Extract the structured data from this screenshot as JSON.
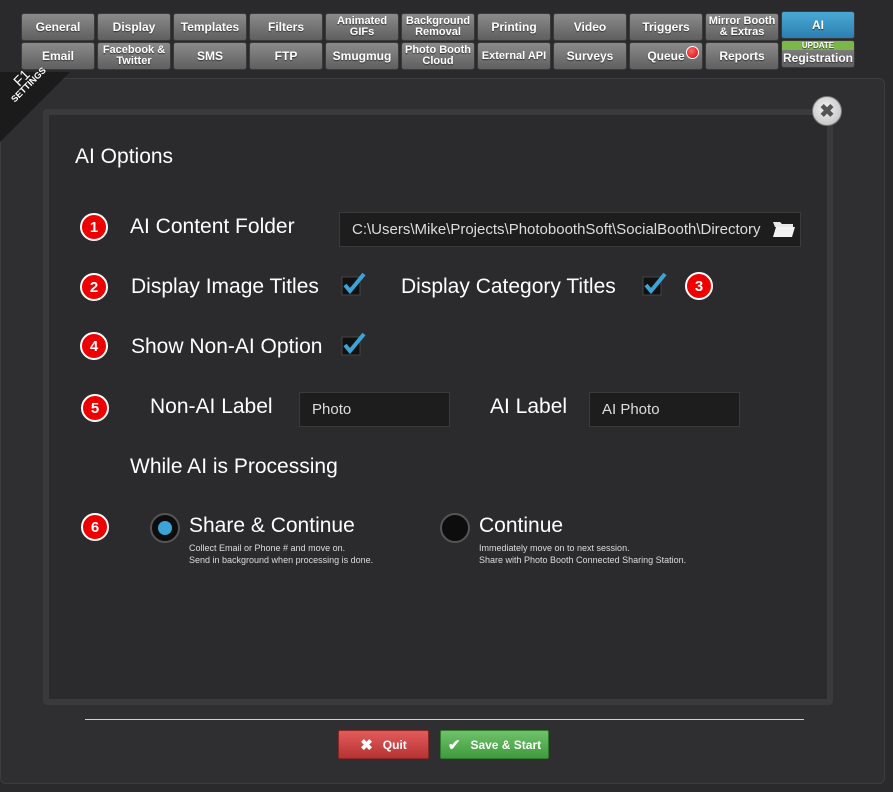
{
  "tabs_row1": [
    {
      "label": "General",
      "active": false
    },
    {
      "label": "Display",
      "active": false
    },
    {
      "label": "Templates",
      "active": false
    },
    {
      "label": "Filters",
      "active": false
    },
    {
      "label": "Animated GIFs",
      "active": false
    },
    {
      "label": "Background Removal",
      "active": false
    },
    {
      "label": "Printing",
      "active": false
    },
    {
      "label": "Video",
      "active": false
    },
    {
      "label": "Triggers",
      "active": false
    },
    {
      "label": "Mirror Booth & Extras",
      "active": false
    },
    {
      "label": "AI",
      "active": true
    }
  ],
  "tabs_row2": [
    {
      "label": "Email"
    },
    {
      "label": "Facebook & Twitter"
    },
    {
      "label": "SMS"
    },
    {
      "label": "FTP"
    },
    {
      "label": "Smugmug"
    },
    {
      "label": "Photo Booth Cloud"
    },
    {
      "label": "External API"
    },
    {
      "label": "Surveys"
    },
    {
      "label": "Queue"
    },
    {
      "label": "Reports"
    },
    {
      "label": "Registration",
      "badge": "UPDATE"
    }
  ],
  "corner": {
    "key": "F1",
    "label": "SETTINGS"
  },
  "section_title": "AI Options",
  "markers": [
    "1",
    "2",
    "3",
    "4",
    "5",
    "6"
  ],
  "content_folder": {
    "label": "AI Content Folder",
    "value": "C:\\Users\\Mike\\Projects\\PhotoboothSoft\\SocialBooth\\Directory"
  },
  "display_image_titles": {
    "label": "Display Image Titles",
    "checked": true
  },
  "display_category_titles": {
    "label": "Display Category Titles",
    "checked": true
  },
  "show_non_ai": {
    "label": "Show Non-AI Option",
    "checked": true
  },
  "non_ai_label": {
    "label": "Non-AI Label",
    "value": "Photo"
  },
  "ai_label": {
    "label": "AI Label",
    "value": "AI Photo"
  },
  "processing_heading": "While AI is Processing",
  "option_share": {
    "title": "Share & Continue",
    "line1": "Collect  Email or Phone # and move on.",
    "line2": "Send in background when processing is done.",
    "selected": true
  },
  "option_continue": {
    "title": "Continue",
    "line1": "Immediately move on to next session.",
    "line2": "Share with Photo Booth Connected Sharing Station.",
    "selected": false
  },
  "buttons": {
    "quit": "Quit",
    "save": "Save & Start"
  },
  "colors": {
    "accent": "#3ba3d6",
    "marker": "#e00000",
    "quit": "#c94545",
    "save": "#55ad51"
  }
}
